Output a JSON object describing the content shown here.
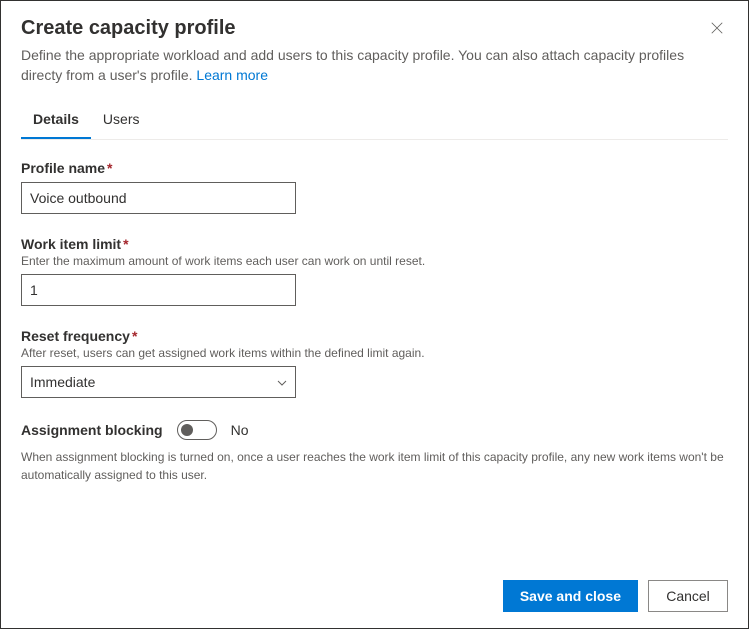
{
  "dialog": {
    "title": "Create capacity profile",
    "description": "Define the appropriate workload and add users to this capacity profile. You can also attach capacity profiles directy from a user's profile.",
    "learn_more": "Learn more"
  },
  "tabs": {
    "details": "Details",
    "users": "Users"
  },
  "fields": {
    "profile_name": {
      "label": "Profile name",
      "value": "Voice outbound"
    },
    "work_item_limit": {
      "label": "Work item limit",
      "help": "Enter the maximum amount of work items each user can work on until reset.",
      "value": "1"
    },
    "reset_frequency": {
      "label": "Reset frequency",
      "help": "After reset, users can get assigned work items within the defined limit again.",
      "value": "Immediate"
    },
    "assignment_blocking": {
      "label": "Assignment blocking",
      "state": "No",
      "help": "When assignment blocking is turned on, once a user reaches the work item limit of this capacity profile, any new work items won't be automatically assigned to this user."
    }
  },
  "footer": {
    "save": "Save and close",
    "cancel": "Cancel"
  }
}
